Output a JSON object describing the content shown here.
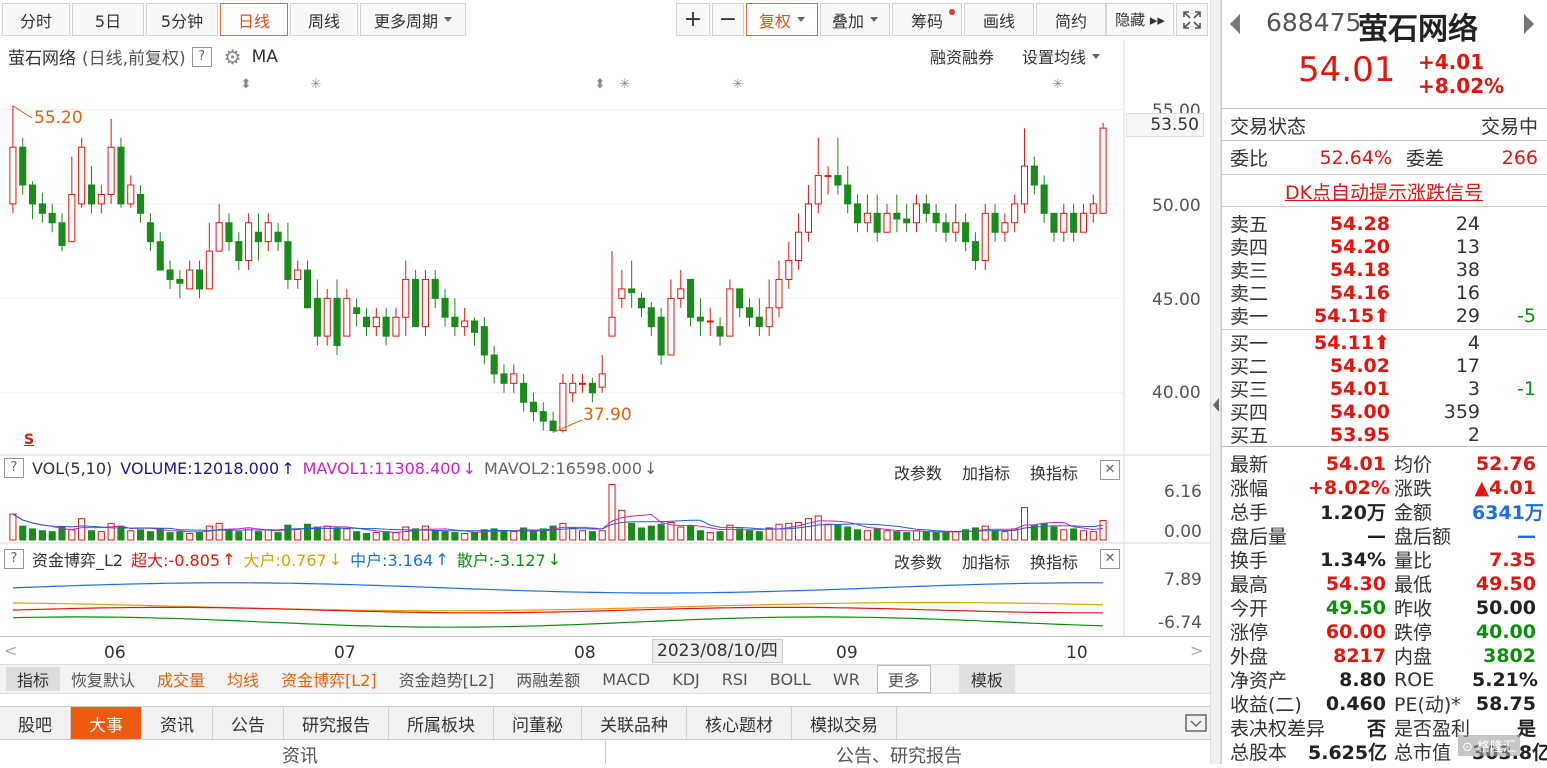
{
  "toolbar": {
    "periods": [
      "分时",
      "5日",
      "5分钟",
      "日线",
      "周线",
      "更多周期"
    ],
    "active_period": "日线",
    "tools": [
      "+",
      "−",
      "复权",
      "叠加",
      "筹码",
      "画线",
      "简约",
      "隐藏 ▸▸"
    ],
    "adjust": "复权",
    "expand_icon": "fullscreen-icon"
  },
  "main_header": {
    "name": "萤石网络",
    "mode": "(日线,前复权)",
    "help": "?",
    "ma": "MA",
    "margin": "融资融券",
    "set_ma": "设置均线"
  },
  "price_axis": [
    "55.00",
    "53.50",
    "50.00",
    "45.00",
    "40.00"
  ],
  "annotations": {
    "high": "55.20",
    "low": "37.90",
    "s_marker": "S"
  },
  "volume_header": {
    "help": "?",
    "title": "VOL(5,10)",
    "volume": "VOLUME:12018.000",
    "mavol1": "MAVOL1:11308.400",
    "mavol2": "MAVOL2:16598.000",
    "btn_params": "改参数",
    "btn_add": "加指标",
    "btn_switch": "换指标",
    "close": "✕",
    "axis_top": "6.16",
    "axis_bottom": "0.00"
  },
  "fund_header": {
    "help": "?",
    "title": "资金博弈_L2",
    "super": "超大:-0.805",
    "large": "大户:0.767",
    "mid": "中户:3.164",
    "retail": "散户:-3.127",
    "btn_params": "改参数",
    "btn_add": "加指标",
    "btn_switch": "换指标",
    "close": "✕",
    "axis_top": "7.89",
    "axis_bottom": "-6.74"
  },
  "x_axis": {
    "labels": [
      "06",
      "07",
      "08",
      "09",
      "10"
    ],
    "cursor_date": "2023/08/10/四"
  },
  "indicator_bar": [
    "指标",
    "恢复默认",
    "成交量",
    "均线",
    "资金博弈[L2]",
    "资金趋势[L2]",
    "两融差额",
    "MACD",
    "KDJ",
    "RSI",
    "BOLL",
    "WR",
    "更多",
    "模板"
  ],
  "bottom_tabs": [
    "股吧",
    "大事",
    "资讯",
    "公告",
    "研究报告",
    "所属板块",
    "问董秘",
    "关联品种",
    "核心题材",
    "模拟交易"
  ],
  "active_tab": "大事",
  "bottom_row": {
    "left": "资讯",
    "right": "公告、研究报告"
  },
  "quote": {
    "code": "688475",
    "name": "萤石网络",
    "price": "54.01",
    "change": "+4.01",
    "change_pct": "+8.02%",
    "status_label": "交易状态",
    "status": "交易中",
    "weibi_label": "委比",
    "weibi": "52.64%",
    "weicha_label": "委差",
    "weicha": "266",
    "dk_link": "DK点自动提示涨跌信号"
  },
  "order_book": {
    "asks": [
      {
        "label": "卖五",
        "price": "54.28",
        "vol": "24",
        "chg": ""
      },
      {
        "label": "卖四",
        "price": "54.20",
        "vol": "13",
        "chg": ""
      },
      {
        "label": "卖三",
        "price": "54.18",
        "vol": "38",
        "chg": ""
      },
      {
        "label": "卖二",
        "price": "54.16",
        "vol": "16",
        "chg": ""
      },
      {
        "label": "卖一",
        "price": "54.15⬆",
        "vol": "29",
        "chg": "-5"
      }
    ],
    "bids": [
      {
        "label": "买一",
        "price": "54.11⬆",
        "vol": "4",
        "chg": ""
      },
      {
        "label": "买二",
        "price": "54.02",
        "vol": "17",
        "chg": ""
      },
      {
        "label": "买三",
        "price": "54.01",
        "vol": "3",
        "chg": "-1"
      },
      {
        "label": "买四",
        "price": "54.00",
        "vol": "359",
        "chg": ""
      },
      {
        "label": "买五",
        "price": "53.95",
        "vol": "2",
        "chg": ""
      }
    ]
  },
  "stats": [
    {
      "l1": "最新",
      "v1": "54.01",
      "c1": "red",
      "l2": "均价",
      "v2": "52.76",
      "c2": "red"
    },
    {
      "l1": "涨幅",
      "v1": "+8.02%",
      "c1": "red",
      "l2": "涨跌",
      "v2": "▲4.01",
      "c2": "red"
    },
    {
      "l1": "总手",
      "v1": "1.20万",
      "c1": "dk",
      "l2": "金额",
      "v2": "6341万",
      "c2": "blue"
    },
    {
      "l1": "盘后量",
      "v1": "—",
      "c1": "dk",
      "l2": "盘后额",
      "v2": "—",
      "c2": "blue"
    },
    {
      "l1": "换手",
      "v1": "1.34%",
      "c1": "dk",
      "l2": "量比",
      "v2": "7.35",
      "c2": "red"
    },
    {
      "l1": "最高",
      "v1": "54.30",
      "c1": "red",
      "l2": "最低",
      "v2": "49.50",
      "c2": "red"
    },
    {
      "l1": "今开",
      "v1": "49.50",
      "c1": "green",
      "l2": "昨收",
      "v2": "50.00",
      "c2": "dk"
    },
    {
      "l1": "涨停",
      "v1": "60.00",
      "c1": "red",
      "l2": "跌停",
      "v2": "40.00",
      "c2": "green"
    },
    {
      "l1": "外盘",
      "v1": "8217",
      "c1": "red",
      "l2": "内盘",
      "v2": "3802",
      "c2": "green"
    },
    {
      "l1": "净资产",
      "v1": "8.80",
      "c1": "dk",
      "l2": "ROE",
      "v2": "5.21%",
      "c2": "dk"
    },
    {
      "l1": "收益(二)",
      "v1": "0.460",
      "c1": "dk",
      "l2": "PE(动)*",
      "v2": "58.75",
      "c2": "dk"
    },
    {
      "l1": "表决权差异",
      "v1": "否",
      "c1": "dk",
      "l2": "是否盈利",
      "v2": "是",
      "c2": "dk"
    },
    {
      "l1": "总股本",
      "v1": "5.625亿",
      "c1": "dk",
      "l2": "总市值",
      "v2": "303.8亿",
      "c2": "dk"
    }
  ],
  "colors": {
    "up": "#e4140f",
    "down": "#1a8a1a",
    "accent": "#f05a10",
    "ma5": "#222222",
    "ma10": "#d4a300",
    "mavol1": "#cc22cc",
    "mavol2": "#1a5fd6"
  },
  "chart_data": {
    "type": "candlestick",
    "ylim": [
      37.5,
      55.5
    ],
    "candles": [
      [
        50,
        53,
        49.5,
        55.2
      ],
      [
        53,
        51,
        50.5,
        53.5
      ],
      [
        51,
        50,
        49.2,
        51.2
      ],
      [
        50,
        49.5,
        49,
        50.6
      ],
      [
        49.5,
        49,
        48.5,
        50
      ],
      [
        49,
        47.8,
        47.5,
        49.5
      ],
      [
        48,
        50.5,
        48,
        52.5
      ],
      [
        50,
        53,
        49.8,
        53.5
      ],
      [
        51,
        50,
        49.5,
        52
      ],
      [
        50,
        50.5,
        49.5,
        51
      ],
      [
        50.5,
        53,
        50,
        54.5
      ],
      [
        53,
        50,
        49.8,
        53.5
      ],
      [
        50,
        51,
        49.8,
        51.5
      ],
      [
        50.5,
        49.5,
        49,
        51
      ],
      [
        49,
        48,
        47.5,
        49.5
      ],
      [
        48,
        46.5,
        46.5,
        48.5
      ],
      [
        46.5,
        46,
        45.5,
        47
      ],
      [
        46,
        45.8,
        45,
        46.5
      ],
      [
        45.5,
        46.5,
        45.5,
        47
      ],
      [
        46.5,
        45.5,
        45,
        47
      ],
      [
        45.5,
        47.5,
        45.5,
        49
      ],
      [
        47.5,
        49,
        47.5,
        50
      ],
      [
        49,
        48,
        47.5,
        49.5
      ],
      [
        48,
        47,
        46.5,
        48.5
      ],
      [
        47,
        49,
        46.5,
        49.5
      ],
      [
        48.5,
        48,
        47,
        49.5
      ],
      [
        48,
        49,
        47.5,
        49.5
      ],
      [
        48.5,
        48,
        47.5,
        49
      ],
      [
        48,
        46,
        45.5,
        49
      ],
      [
        46,
        46.5,
        45.5,
        47
      ],
      [
        46.5,
        44.5,
        44.5,
        47
      ],
      [
        45,
        43,
        42.5,
        46
      ],
      [
        43,
        45,
        42.5,
        45.5
      ],
      [
        45,
        42.5,
        42,
        46
      ],
      [
        43,
        45,
        43,
        45.5
      ],
      [
        44.5,
        44.2,
        43.5,
        45
      ],
      [
        44,
        43.5,
        43,
        44.5
      ],
      [
        43.5,
        44,
        43,
        44.5
      ],
      [
        44,
        43,
        42.5,
        44.5
      ],
      [
        43,
        44,
        43,
        44.5
      ],
      [
        44,
        46,
        43,
        47
      ],
      [
        46,
        43.5,
        43.5,
        46.5
      ],
      [
        43.5,
        46,
        43,
        46.5
      ],
      [
        46,
        45,
        44.5,
        46.5
      ],
      [
        45,
        44,
        43.5,
        45.5
      ],
      [
        44,
        43.5,
        43,
        45
      ],
      [
        43.5,
        43.8,
        43,
        44.5
      ],
      [
        43.8,
        43.2,
        42.5,
        44
      ],
      [
        43.5,
        42,
        41.5,
        44
      ],
      [
        42,
        41,
        40.5,
        42.5
      ],
      [
        41,
        40.5,
        40,
        41.5
      ],
      [
        40.5,
        41,
        40,
        41.5
      ],
      [
        40.5,
        39.5,
        39,
        41
      ],
      [
        39.5,
        39,
        38.5,
        40
      ],
      [
        39,
        38.5,
        38,
        39.5
      ],
      [
        38.5,
        38,
        37.9,
        39
      ],
      [
        38,
        40.5,
        37.9,
        41
      ],
      [
        40,
        40.5,
        39.5,
        41
      ],
      [
        40.5,
        40.5,
        40,
        41
      ],
      [
        40.5,
        40,
        39.5,
        40.8
      ],
      [
        40.3,
        41,
        40,
        42
      ],
      [
        43,
        44,
        43,
        47.5
      ],
      [
        45,
        45.5,
        44.5,
        46.5
      ],
      [
        45.5,
        45.3,
        44.5,
        47
      ],
      [
        45,
        44.5,
        44,
        45.3
      ],
      [
        44.5,
        43.5,
        43,
        44.8
      ],
      [
        44,
        42,
        41.5,
        44.5
      ],
      [
        42,
        45,
        42,
        46
      ],
      [
        45,
        45.5,
        44.5,
        46.5
      ],
      [
        46,
        44,
        43.5,
        46
      ],
      [
        44,
        43.8,
        43,
        45
      ],
      [
        43.8,
        43.8,
        43,
        44.5
      ],
      [
        43.5,
        43,
        42.5,
        44
      ],
      [
        43,
        45.5,
        43,
        46
      ],
      [
        45.5,
        44.5,
        44,
        45.5
      ],
      [
        44.5,
        44,
        43.5,
        45
      ],
      [
        44,
        43.5,
        43,
        45
      ],
      [
        43.5,
        44.5,
        43,
        46
      ],
      [
        44.5,
        46,
        44,
        47
      ],
      [
        46,
        47,
        45.5,
        48
      ],
      [
        47,
        48.5,
        46.5,
        49.5
      ],
      [
        48.5,
        50,
        48,
        51
      ],
      [
        50,
        51.5,
        49.5,
        53.5
      ],
      [
        51.5,
        51.5,
        50.5,
        52
      ],
      [
        51.5,
        51,
        50.5,
        53.5
      ],
      [
        51,
        50,
        49.5,
        52
      ],
      [
        50,
        49,
        48.5,
        50.5
      ],
      [
        49,
        49.5,
        48.5,
        50.5
      ],
      [
        49.5,
        48.5,
        48,
        50.5
      ],
      [
        48.5,
        49.5,
        48.5,
        50
      ],
      [
        49.5,
        49.2,
        48.5,
        50.5
      ],
      [
        49.2,
        49,
        48.5,
        50
      ],
      [
        49,
        50,
        48.5,
        50.5
      ],
      [
        50,
        49.5,
        49,
        50.5
      ],
      [
        49.5,
        49,
        48.5,
        50
      ],
      [
        49,
        48.5,
        48,
        49.5
      ],
      [
        48.5,
        49,
        48,
        50
      ],
      [
        49,
        48,
        47.5,
        49.5
      ],
      [
        48,
        47,
        46.5,
        48.5
      ],
      [
        47,
        49.5,
        46.5,
        50
      ],
      [
        49.5,
        48.5,
        48,
        50
      ],
      [
        48.5,
        49,
        48,
        49.5
      ],
      [
        49,
        50,
        48.5,
        50.5
      ],
      [
        50,
        52,
        49.5,
        54
      ],
      [
        52,
        51,
        50.5,
        52.5
      ],
      [
        51,
        49.5,
        49,
        51.5
      ],
      [
        49.5,
        48.5,
        48,
        49.5
      ],
      [
        48.5,
        49.5,
        48,
        50
      ],
      [
        49.5,
        48.5,
        48,
        50
      ],
      [
        48.5,
        49.5,
        48.5,
        50
      ],
      [
        49.5,
        50,
        49,
        50.5
      ],
      [
        49.5,
        54.01,
        49.5,
        54.3
      ]
    ],
    "volumes": [
      2.8,
      1.5,
      1.2,
      1.0,
      0.9,
      1.4,
      1.1,
      2.3,
      1.0,
      0.9,
      1.8,
      1.5,
      1.0,
      1.1,
      0.9,
      1.2,
      0.8,
      0.9,
      0.7,
      0.8,
      1.5,
      1.8,
      1.1,
      0.9,
      1.3,
      0.9,
      1.1,
      0.8,
      1.6,
      1.2,
      1.7,
      1.4,
      1.5,
      1.3,
      1.2,
      0.9,
      0.7,
      0.8,
      0.9,
      0.8,
      1.4,
      1.2,
      1.5,
      1.0,
      0.9,
      0.8,
      0.7,
      0.8,
      1.1,
      1.2,
      1.0,
      0.9,
      1.3,
      1.0,
      1.2,
      1.5,
      1.8,
      1.3,
      1.0,
      0.9,
      1.0,
      6.0,
      3.2,
      1.8,
      1.3,
      1.5,
      1.7,
      1.9,
      1.4,
      1.5,
      1.0,
      0.8,
      0.9,
      1.6,
      1.2,
      1.0,
      0.9,
      1.3,
      1.7,
      1.8,
      1.9,
      2.3,
      2.6,
      1.7,
      1.6,
      1.4,
      1.1,
      1.0,
      1.2,
      1.0,
      0.9,
      0.8,
      1.0,
      0.9,
      0.8,
      0.8,
      0.9,
      1.1,
      1.3,
      1.5,
      1.0,
      0.9,
      1.2,
      3.5,
      1.6,
      1.8,
      1.4,
      1.1,
      1.2,
      1.0,
      0.9,
      2.1
    ],
    "volume_axis": [
      0,
      6.16
    ],
    "fund_axis": [
      -6.74,
      7.89
    ]
  }
}
